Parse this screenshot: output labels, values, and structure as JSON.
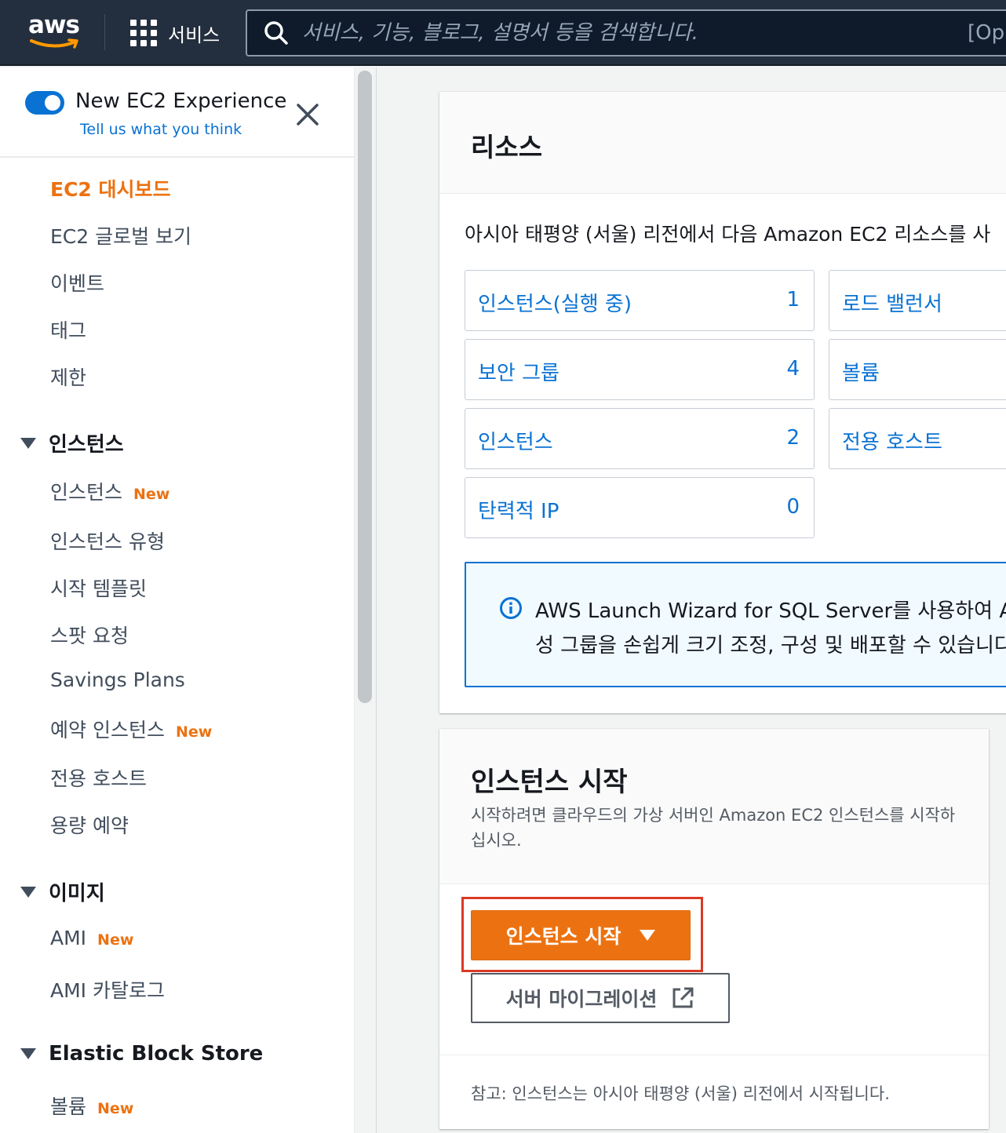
{
  "topnav": {
    "logo_text": "aws",
    "services_label": "서비스",
    "search_placeholder": "서비스, 기능, 블로그, 설명서 등을 검색합니다.",
    "search_shortcut": "[Op"
  },
  "sidebar": {
    "experience_title": "New EC2 Experience",
    "feedback_link": "Tell us what you think",
    "toggle_on": true,
    "top_items": [
      {
        "label": "EC2 대시보드",
        "active": true
      },
      {
        "label": "EC2 글로벌 보기"
      },
      {
        "label": "이벤트"
      },
      {
        "label": "태그"
      },
      {
        "label": "제한"
      }
    ],
    "sections": [
      {
        "title": "인스턴스",
        "items": [
          {
            "label": "인스턴스",
            "badge": "New"
          },
          {
            "label": "인스턴스 유형"
          },
          {
            "label": "시작 템플릿"
          },
          {
            "label": "스팟 요청"
          },
          {
            "label": "Savings Plans"
          },
          {
            "label": "예약 인스턴스",
            "badge": "New"
          },
          {
            "label": "전용 호스트"
          },
          {
            "label": "용량 예약"
          }
        ]
      },
      {
        "title": "이미지",
        "items": [
          {
            "label": "AMI",
            "badge": "New"
          },
          {
            "label": "AMI 카탈로그"
          }
        ]
      },
      {
        "title": "Elastic Block Store",
        "items": [
          {
            "label": "볼륨",
            "badge": "New"
          }
        ]
      }
    ]
  },
  "resources": {
    "title": "리소스",
    "description": "아시아 태평양 (서울) 리전에서 다음 Amazon EC2 리소스를 사",
    "tiles": [
      {
        "label": "인스턴스(실행 중)",
        "count": "1"
      },
      {
        "label": "로드 밸런서",
        "count": ""
      },
      {
        "label": "보안 그룹",
        "count": "4"
      },
      {
        "label": "볼륨",
        "count": ""
      },
      {
        "label": "인스턴스",
        "count": "2"
      },
      {
        "label": "전용 호스트",
        "count": ""
      },
      {
        "label": "탄력적 IP",
        "count": "0"
      }
    ],
    "info_line1": "AWS Launch Wizard for SQL Server를 사용하여 A",
    "info_line2": "성 그룹을 손쉽게 크기 조정, 구성 및 배포할 수 있습니다"
  },
  "launch": {
    "title": "인스턴스 시작",
    "description": "시작하려면 클라우드의 가상 서버인 Amazon EC2 인스턴스를 시작하십시오.",
    "launch_button": "인스턴스 시작",
    "migrate_button": "서버 마이그레이션",
    "note": "참고: 인스턴스는 아시아 태평양 (서울) 리전에서 시작됩니다."
  },
  "colors": {
    "nav_bg": "#232f3e",
    "accent_orange": "#ec7211",
    "link_blue": "#0972d3",
    "highlight_red": "#d93a26"
  }
}
